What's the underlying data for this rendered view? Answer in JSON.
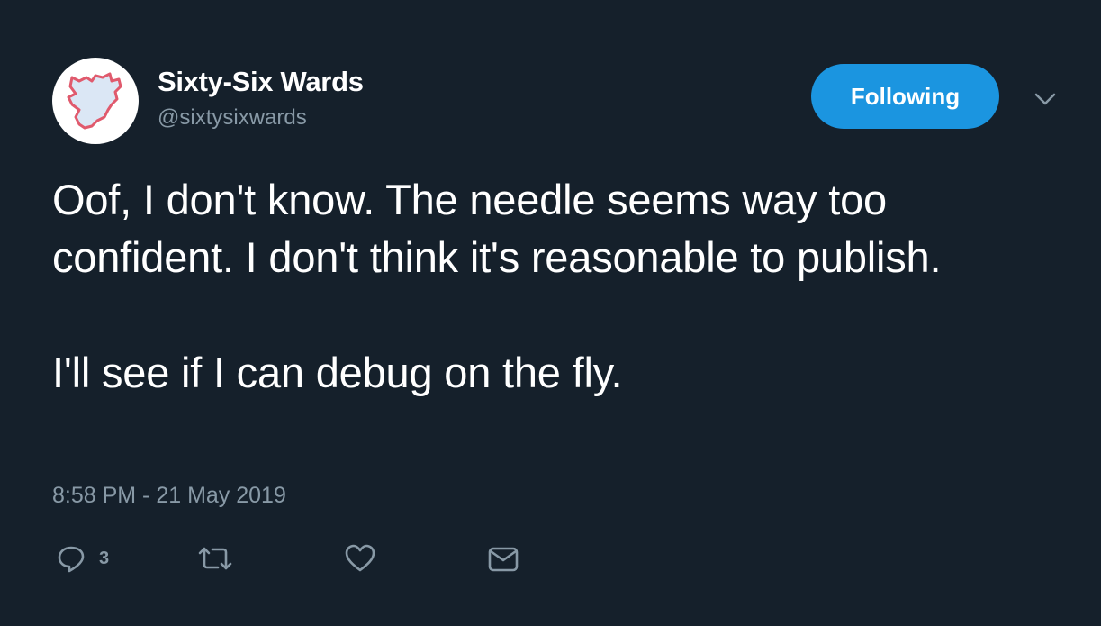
{
  "author": {
    "display_name": "Sixty-Six Wards",
    "handle": "@sixtysixwards",
    "avatar_icon": "philadelphia-map-outline-icon"
  },
  "follow_button": {
    "label": "Following",
    "color": "#1b95e0"
  },
  "menu_icon": "chevron-down-icon",
  "tweet": {
    "paragraph_1": "Oof, I don't know. The needle seems way too confident. I don't think it's reasonable to publish.",
    "paragraph_2": "I'll see if I can debug on the fly.",
    "timestamp": "8:58 PM - 21 May 2019"
  },
  "actions": {
    "reply_count": "3",
    "reply_icon": "reply-icon",
    "retweet_icon": "retweet-icon",
    "like_icon": "heart-icon",
    "dm_icon": "envelope-icon"
  },
  "colors": {
    "background": "#15202b",
    "secondary_text": "#8899a6",
    "avatar_outline": "#e05a6d"
  }
}
